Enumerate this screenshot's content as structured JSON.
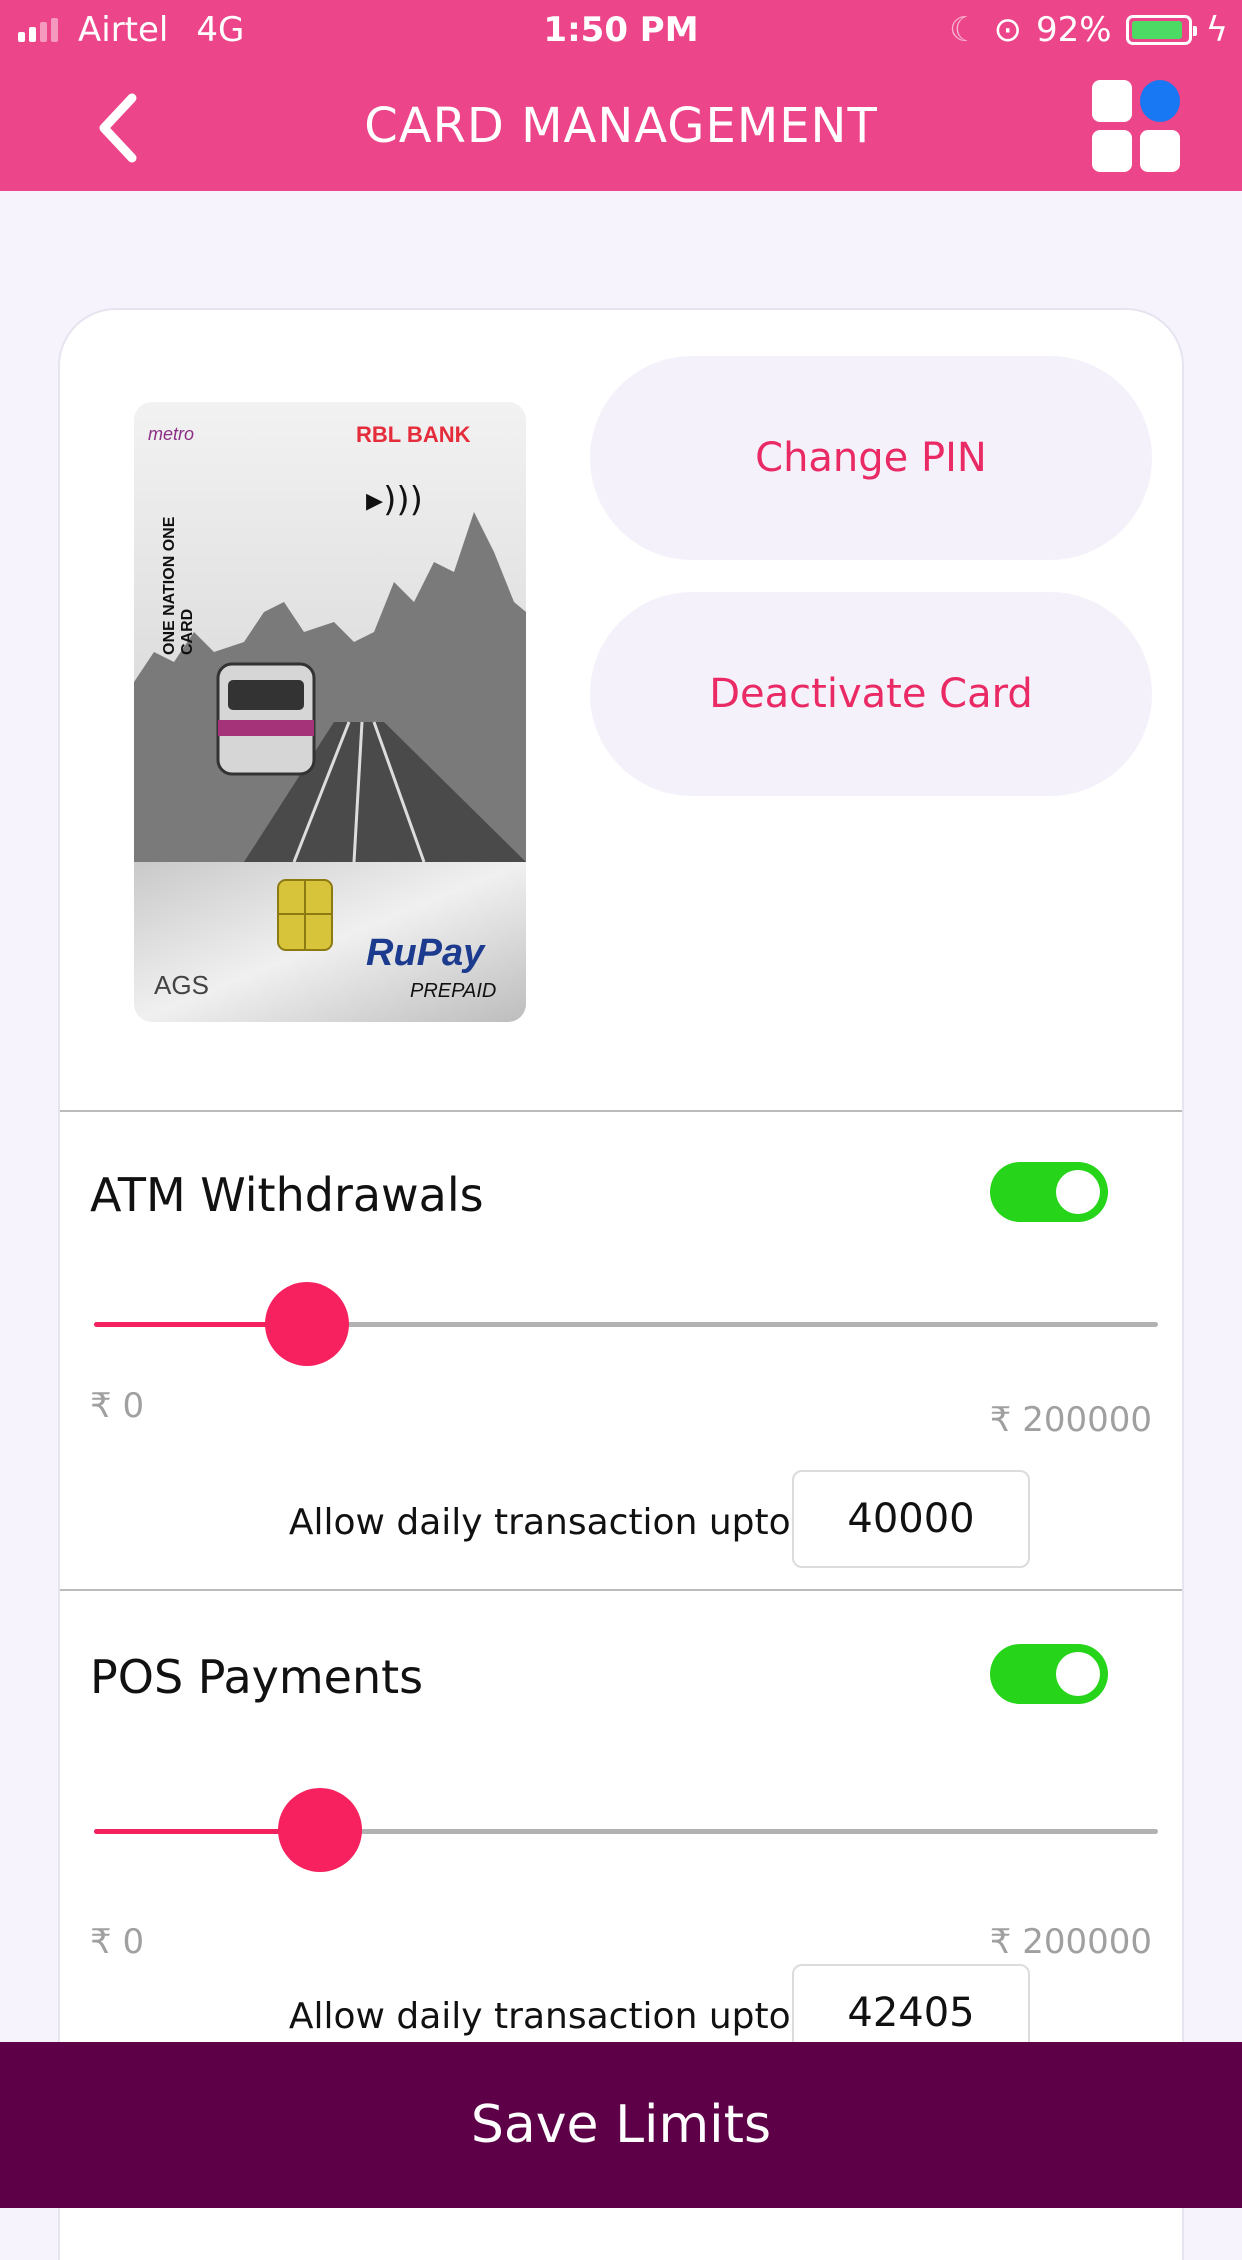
{
  "status_bar": {
    "carrier": "Airtel",
    "network": "4G",
    "time": "1:50 PM",
    "battery": "92%",
    "battery_level": 0.92
  },
  "header": {
    "title": "CARD MANAGEMENT",
    "back_icon": "chevron-left-icon",
    "menu_icon": "apps-grid-icon"
  },
  "card": {
    "brand_bank": "RBL BANK",
    "brand_top_left": "metro",
    "tagline": "ONE NATION ONE CARD",
    "network": "RuPay",
    "network_sub": "PREPAID",
    "issuer_logo": "AGS"
  },
  "actions": {
    "change_pin": "Change PIN",
    "deactivate": "Deactivate Card"
  },
  "limits": [
    {
      "title": "ATM Withdrawals",
      "enabled": true,
      "min_label": "₹ 0",
      "max_label": "₹ 200000",
      "allow_label": "Allow daily transaction upto ₹",
      "value": "40000",
      "fraction": 0.2
    },
    {
      "title": "POS Payments",
      "enabled": true,
      "min_label": "₹ 0",
      "max_label": "₹ 200000",
      "allow_label": "Allow daily transaction upto ₹",
      "value": "42405",
      "fraction": 0.212
    }
  ],
  "footer": {
    "save_label": "Save Limits"
  },
  "colors": {
    "header": "#ed458a",
    "accent": "#f3215e",
    "toggle_on": "#26d41a",
    "save_bar": "#5e0048"
  }
}
